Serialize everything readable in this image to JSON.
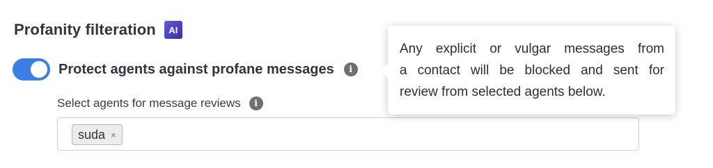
{
  "section": {
    "title": "Profanity filteration",
    "badge": "AI"
  },
  "toggle": {
    "label": "Protect agents against profane messages",
    "enabled": true,
    "accent_color": "#3c7ee4",
    "info_icon": "i"
  },
  "reviewers": {
    "label": "Select agents for message reviews",
    "info_icon": "i",
    "selected": [
      {
        "label": "suda",
        "remove": "×"
      }
    ]
  },
  "tooltip": {
    "lines": [
      "Any explicit or vulgar messages from",
      "a contact will be blocked and sent for",
      "review from selected agents below."
    ]
  }
}
